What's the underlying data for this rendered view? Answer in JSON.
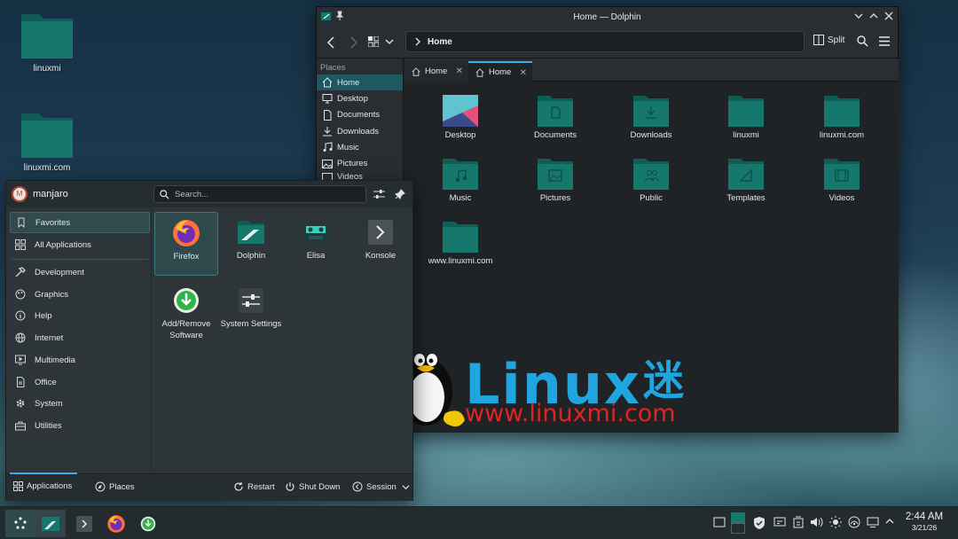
{
  "desktop": {
    "icons": [
      {
        "label": "linuxmi"
      },
      {
        "label": "linuxmi.com"
      }
    ]
  },
  "dolphin": {
    "title": "Home — Dolphin",
    "toolbar": {
      "split_label": "Split"
    },
    "breadcrumb": "Home",
    "places_header": "Places",
    "places": [
      {
        "label": "Home"
      },
      {
        "label": "Desktop"
      },
      {
        "label": "Documents"
      },
      {
        "label": "Downloads"
      },
      {
        "label": "Music"
      },
      {
        "label": "Pictures"
      },
      {
        "label": "Videos"
      }
    ],
    "tabs": [
      {
        "label": "Home"
      },
      {
        "label": "Home"
      }
    ],
    "files": [
      {
        "label": "Desktop"
      },
      {
        "label": "Documents"
      },
      {
        "label": "Downloads"
      },
      {
        "label": "linuxmi"
      },
      {
        "label": "linuxmi.com"
      },
      {
        "label": "Music"
      },
      {
        "label": "Pictures"
      },
      {
        "label": "Public"
      },
      {
        "label": "Templates"
      },
      {
        "label": "Videos"
      },
      {
        "label": "www.linuxmi.com"
      }
    ]
  },
  "launcher": {
    "username": "manjaro",
    "avatar_letter": "M",
    "search_placeholder": "Search...",
    "categories": [
      {
        "label": "Favorites"
      },
      {
        "label": "All Applications"
      },
      {
        "label": "Development"
      },
      {
        "label": "Graphics"
      },
      {
        "label": "Help"
      },
      {
        "label": "Internet"
      },
      {
        "label": "Multimedia"
      },
      {
        "label": "Office"
      },
      {
        "label": "System"
      },
      {
        "label": "Utilities"
      }
    ],
    "apps": [
      {
        "label": "Firefox"
      },
      {
        "label": "Dolphin"
      },
      {
        "label": "Elisa"
      },
      {
        "label": "Konsole"
      },
      {
        "label": "Add/Remove Software"
      },
      {
        "label": "System Settings"
      }
    ],
    "bottom": {
      "applications": "Applications",
      "places": "Places",
      "restart": "Restart",
      "shutdown": "Shut Down",
      "session": "Session"
    }
  },
  "logo": {
    "word": "Linux",
    "glyph": "迷",
    "url": "www.linuxmi.com"
  },
  "taskbar": {
    "time": "2:44 AM",
    "date": "3/21/26"
  },
  "colors": {
    "accent": "#1e5860",
    "folder": "#16786c",
    "folder_dark": "#0f5d54"
  }
}
